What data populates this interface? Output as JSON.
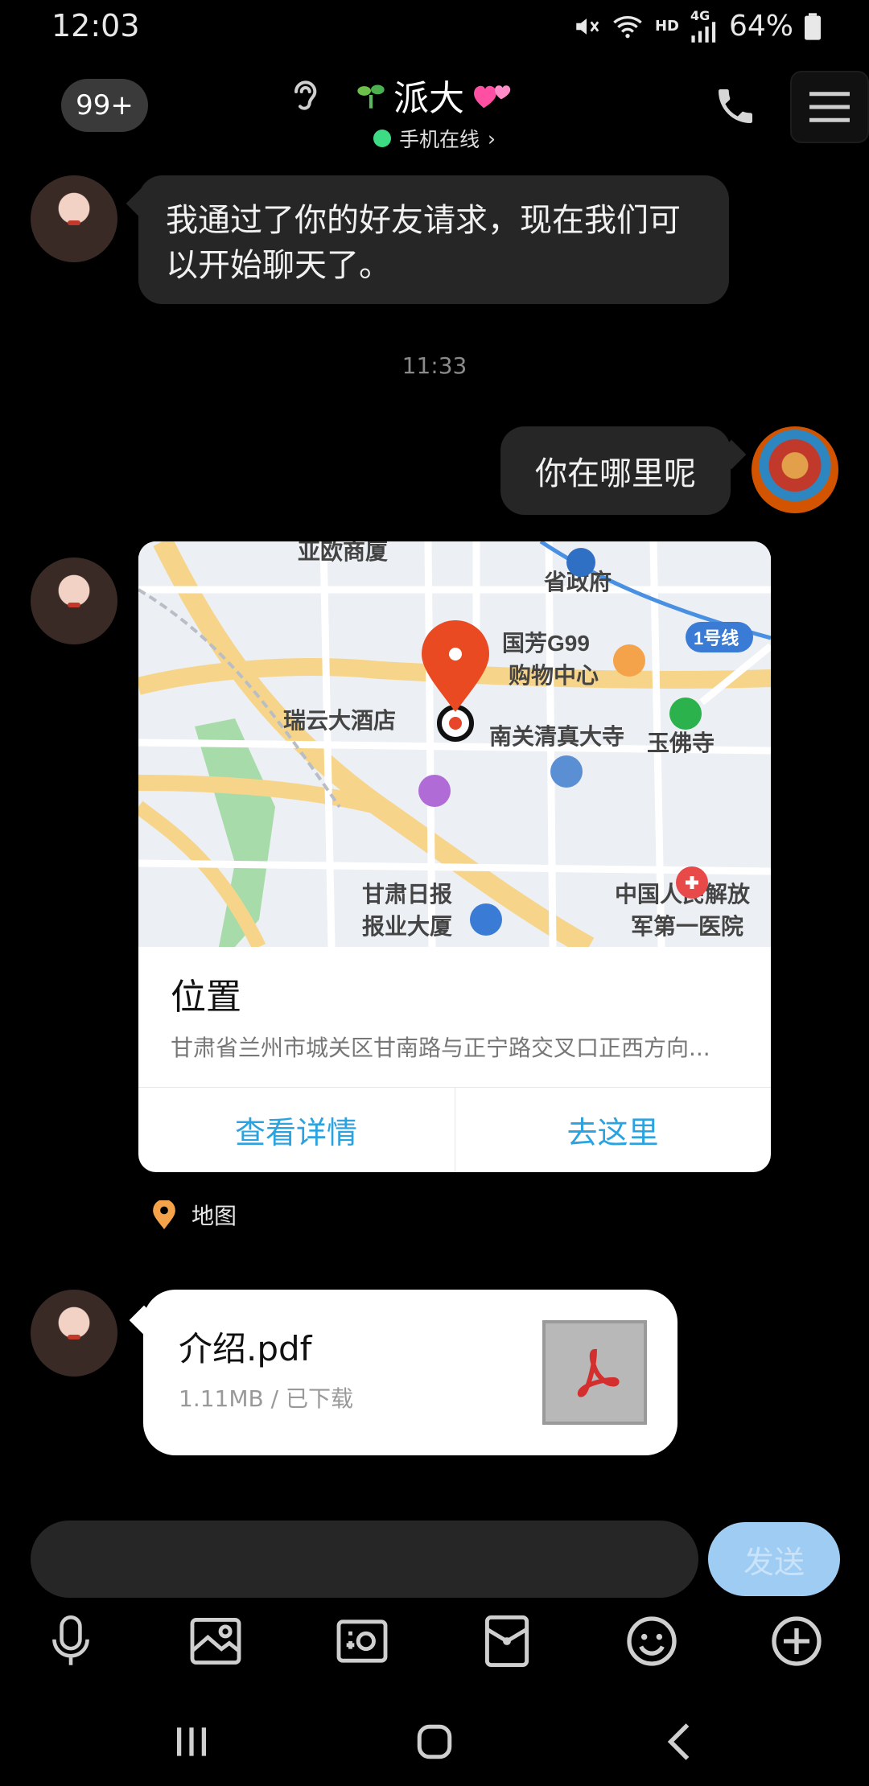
{
  "status_bar": {
    "time": "12:03",
    "network": "4G",
    "hd": "HD",
    "battery": "64%"
  },
  "header": {
    "back_badge": "99+",
    "contact_name": "派大",
    "status": "手机在线",
    "status_chevron": "›"
  },
  "messages": {
    "incoming_1": "我通过了你的好友请求，现在我们可以开始聊天了。",
    "timestamp": "11:33",
    "outgoing_1": "你在哪里呢"
  },
  "location_card": {
    "title": "位置",
    "address": "甘肃省兰州市城关区甘南路与正宁路交叉口正西方向...",
    "detail_button": "查看详情",
    "go_button": "去这里",
    "source_label": "地图",
    "map_labels": {
      "l1": "亚欧商厦",
      "l2": "省政府",
      "l3": "国芳G99",
      "l4": "购物中心",
      "l5": "1号线",
      "l6": "玉佛寺",
      "l7": "瑞云大酒店",
      "l8": "南关清真大寺",
      "l9": "甘肃日报",
      "l10": "报业大厦",
      "l11": "中国人民解放",
      "l12": "军第一医院"
    }
  },
  "file_message": {
    "name": "介绍.pdf",
    "meta": "1.11MB / 已下载"
  },
  "input": {
    "placeholder": "",
    "send_label": "发送"
  },
  "toolbar": [
    "mic-icon",
    "image-icon",
    "camera-icon",
    "red-packet-icon",
    "emoji-icon",
    "plus-icon"
  ],
  "colors": {
    "link_blue": "#2aa3e0",
    "send_button": "#9fccf3",
    "online_green": "#3ddc84",
    "bubble_dark": "#262626"
  }
}
